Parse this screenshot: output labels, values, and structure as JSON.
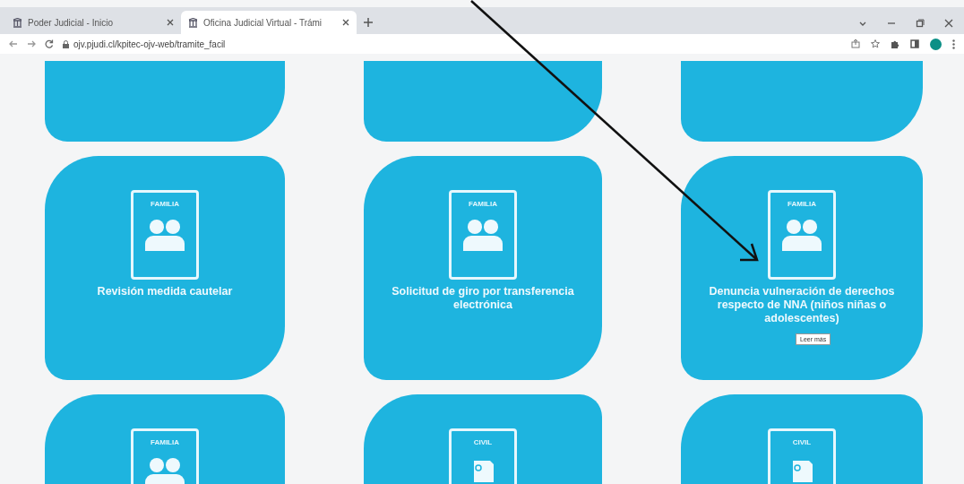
{
  "browser": {
    "tabs": [
      {
        "title": "Poder Judicial - Inicio",
        "selected": false
      },
      {
        "title": "Oficina Judicial Virtual - Trámi",
        "selected": true
      }
    ],
    "address": "ojv.pjudi.cl/kpitec-ojv-web/tramite_facil"
  },
  "card_rows": [
    {
      "kind": "cut_top",
      "cards": [
        {
          "kind": "blank"
        },
        {
          "kind": "blank"
        },
        {
          "kind": "blank"
        }
      ]
    },
    {
      "kind": "whole",
      "cards": [
        {
          "kind": "people",
          "category": "FAMILIA",
          "title": "Revisión medida cautelar"
        },
        {
          "kind": "people",
          "category": "FAMILIA",
          "title": "Solicitud de giro por transferencia electrónica"
        },
        {
          "kind": "people",
          "category": "FAMILIA",
          "title": "Denuncia vulneración de derechos respecto de NNA (niños niñas o adolescentes)",
          "tooltip": "Leer más"
        }
      ]
    },
    {
      "kind": "cut_bottom",
      "cards": [
        {
          "kind": "people",
          "category": "FAMILIA"
        },
        {
          "kind": "document",
          "category": "CIVIL"
        },
        {
          "kind": "document",
          "category": "CIVIL"
        }
      ]
    }
  ]
}
